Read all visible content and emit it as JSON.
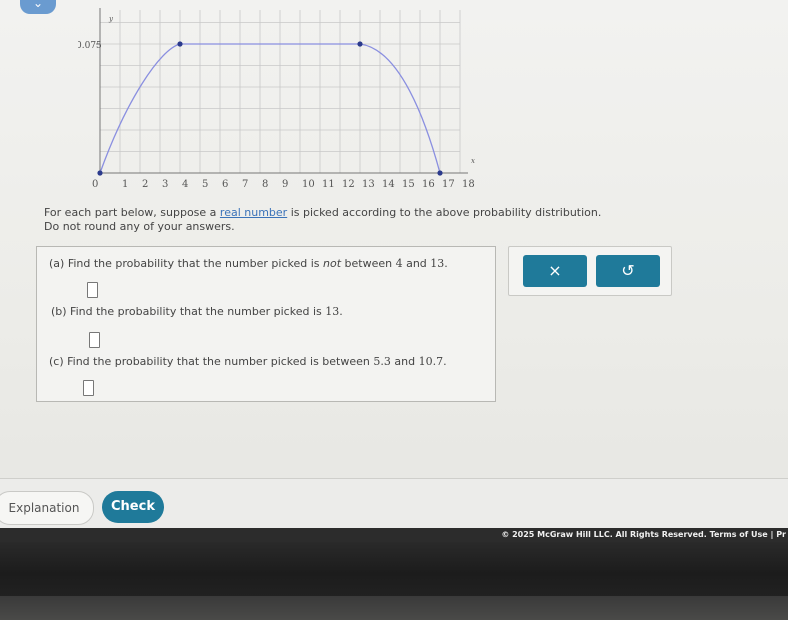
{
  "graph": {
    "y_tick": "0.075",
    "y_axis_letter": "y",
    "x_axis_letter": "x",
    "x_ticks": [
      "0",
      "1",
      "2",
      "3",
      "4",
      "5",
      "6",
      "7",
      "8",
      "9",
      "10",
      "11",
      "12",
      "13",
      "14",
      "15",
      "16",
      "17",
      "18"
    ]
  },
  "chart_data": {
    "type": "line",
    "xlim": [
      0,
      18
    ],
    "ylim": [
      0,
      0.09
    ],
    "grid": true,
    "points": [
      {
        "x": 0,
        "y": 0
      },
      {
        "x": 4,
        "y": 0.075
      },
      {
        "x": 13,
        "y": 0.075
      },
      {
        "x": 17,
        "y": 0
      }
    ],
    "curve_color": "#8a8fe0",
    "point_color": "#2b3a8c"
  },
  "prompt": {
    "before_link": "For each part below, suppose a ",
    "link_text": "real number",
    "after_link": " is picked according to the above probability distribution.",
    "line2": "Do not round any of your answers."
  },
  "parts": {
    "a": {
      "pre": "(a) Find the probability that the number picked is ",
      "emph": "not",
      "mid": " between ",
      "n1": "4",
      "and": " and ",
      "n2": "13",
      "end": "."
    },
    "b": {
      "pre": "(b) Find the probability that the number picked is ",
      "n1": "13",
      "end": "."
    },
    "c": {
      "pre": "(c) Find the probability that the number picked is between ",
      "n1": "5.3",
      "and": " and ",
      "n2": "10.7",
      "end": "."
    }
  },
  "tools": {
    "clear_icon": "×",
    "undo_icon": "↺"
  },
  "buttons": {
    "explanation": "Explanation",
    "check": "Check"
  },
  "footer": {
    "text": "© 2025 McGraw Hill LLC. All Rights Reserved.   Terms of Use  |  Pr"
  }
}
